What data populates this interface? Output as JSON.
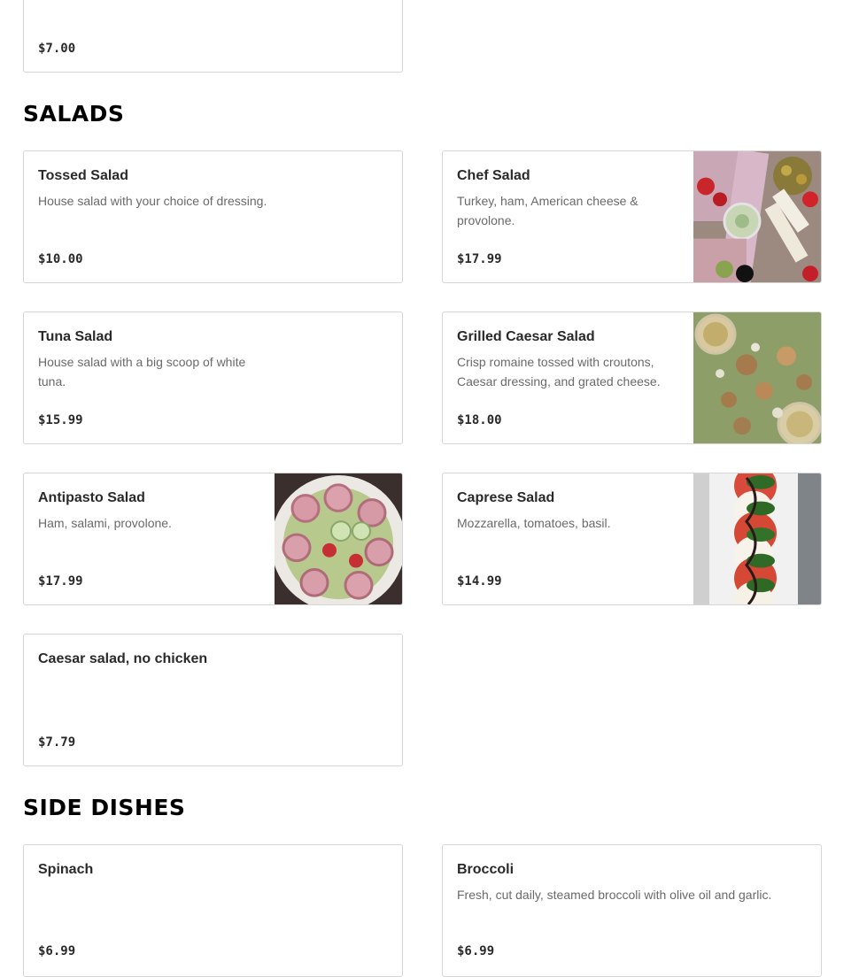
{
  "previous_section": {
    "last_item": {
      "price": "$7.00"
    }
  },
  "salads": {
    "title": "SALADS",
    "items": [
      {
        "name": "Tossed Salad",
        "description": "House salad with your choice of dressing.",
        "price": "$10.00"
      },
      {
        "name": "Chef Salad",
        "description": "Turkey, ham, American cheese & provolone.",
        "price": "$17.99",
        "image": "chef-salad-photo"
      },
      {
        "name": "Tuna Salad",
        "description": "House salad with a big scoop of white tuna.",
        "price": "$15.99"
      },
      {
        "name": "Grilled Caesar Salad",
        "description": "Crisp romaine tossed with croutons, Caesar dressing, and grated cheese.",
        "price": "$18.00",
        "image": "grilled-caesar-salad-photo"
      },
      {
        "name": "Antipasto Salad",
        "description": "Ham, salami, provolone.",
        "price": "$17.99",
        "image": "antipasto-salad-photo"
      },
      {
        "name": "Caprese Salad",
        "description": "Mozzarella, tomatoes, basil.",
        "price": "$14.99",
        "image": "caprese-salad-photo"
      },
      {
        "name": "Caesar salad, no chicken",
        "description": "",
        "price": "$7.79"
      }
    ]
  },
  "side_dishes": {
    "title": "SIDE DISHES",
    "items": [
      {
        "name": "Spinach",
        "description": "",
        "price": "$6.99"
      },
      {
        "name": "Broccoli",
        "description": "Fresh, cut daily, steamed broccoli with olive oil and garlic.",
        "price": "$6.99"
      }
    ]
  }
}
